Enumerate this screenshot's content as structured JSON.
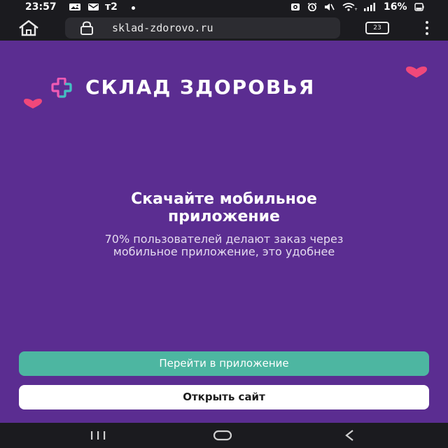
{
  "status_bar": {
    "time": "23:57",
    "carrier": "т2",
    "battery": "16%",
    "icons": [
      "gallery-icon",
      "mail-icon",
      "alarm-icon",
      "clock-icon",
      "mute-icon",
      "wifi-icon",
      "signal-icon",
      "battery-icon"
    ]
  },
  "browser": {
    "url": "sklad-zdorovo.ru",
    "tab_count": "23",
    "icons": [
      "home-icon",
      "lock-icon",
      "tabs-icon",
      "menu-icon"
    ]
  },
  "page": {
    "logo_text": "СКЛАД ЗДОРОВЬЯ",
    "headline_line1": "Скачайте мобильное",
    "headline_line2": "приложение",
    "subtext_line1": "70% пользователей делают заказ через",
    "subtext_line2": "мобильное приложение, это удобнее",
    "primary_button": "Перейти в приложение",
    "secondary_button": "Открыть сайт"
  },
  "colors": {
    "background": "#5b2d91",
    "primary_button": "#4db6a1",
    "secondary_button": "#ffffff",
    "heart": "#f0487a",
    "logo_plus_pink": "#f05ab4",
    "logo_plus_teal": "#3fc2c2",
    "system_bar": "#1b1b1f"
  },
  "nav_bar": {
    "icons": [
      "recents-icon",
      "home-circle-icon",
      "back-icon"
    ]
  }
}
